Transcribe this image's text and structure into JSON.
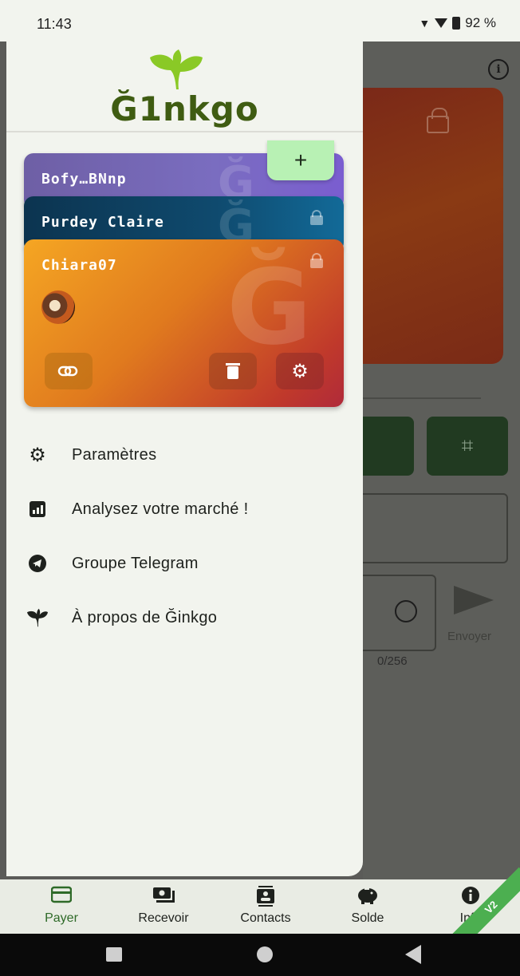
{
  "status_bar": {
    "time": "11:43",
    "battery": "92 %"
  },
  "drawer": {
    "logo_text": "Ğ1nkgo",
    "add_label": "+",
    "cards": [
      {
        "name": "Bofy…BNnp",
        "locked": false
      },
      {
        "name": "Purdey Claire",
        "locked": true
      },
      {
        "name": "Chiara07",
        "locked": true
      }
    ],
    "menu": [
      {
        "label": "Paramètres",
        "icon": "gear-icon"
      },
      {
        "label": "Analysez votre marché !",
        "icon": "chart-icon"
      },
      {
        "label": "Groupe Telegram",
        "icon": "telegram-icon"
      },
      {
        "label": "À propos de Ğinkgo",
        "icon": "ginkgo-leaf-icon"
      }
    ]
  },
  "background_screen": {
    "counter": "0/256",
    "send_label": "Envoyer"
  },
  "bottom_nav": {
    "items": [
      {
        "label": "Payer",
        "icon": "card-icon",
        "active": true
      },
      {
        "label": "Recevoir",
        "icon": "cash-icon",
        "active": false
      },
      {
        "label": "Contacts",
        "icon": "contacts-icon",
        "active": false
      },
      {
        "label": "Solde",
        "icon": "piggy-bank-icon",
        "active": false
      },
      {
        "label": "Info",
        "icon": "info-icon",
        "active": false
      }
    ],
    "version_ribbon": "V2"
  },
  "colors": {
    "accent": "#3f5c12",
    "active_nav": "#2e6a28",
    "fab": "#b8f1b4"
  }
}
